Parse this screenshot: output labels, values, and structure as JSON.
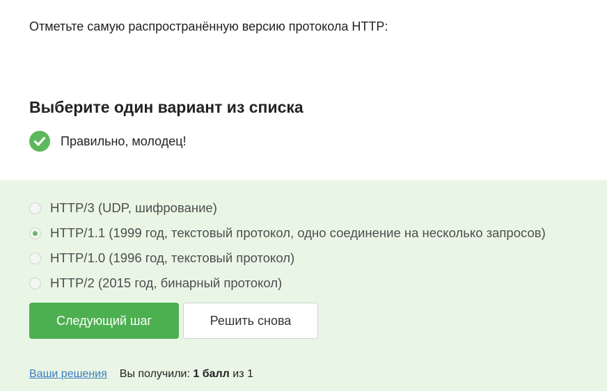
{
  "question": {
    "text": "Отметьте самую распространённую версию протокола HTTP:"
  },
  "choose_title": "Выберите один вариант из списка",
  "feedback": {
    "icon": "check-circle-icon",
    "text": "Правильно, молодец!",
    "color": "#5cb85c"
  },
  "options": [
    {
      "label": "HTTP/3 (UDP, шифрование)",
      "checked": false
    },
    {
      "label": "HTTP/1.1 (1999 год, текстовый протокол, одно соединение на несколько запросов)",
      "checked": true
    },
    {
      "label": "HTTP/1.0 (1996 год, текстовый протокол)",
      "checked": false
    },
    {
      "label": "HTTP/2 (2015 год, бинарный протокол)",
      "checked": false
    }
  ],
  "buttons": {
    "next_label": "Следующий шаг",
    "retry_label": "Решить снова"
  },
  "footer": {
    "solutions_link": "Ваши решения",
    "score_prefix": "Вы получили:",
    "score_value": "1 балл",
    "score_suffix": "из 1"
  },
  "colors": {
    "panel_bg": "#e9f6e6",
    "accent": "#4caf50",
    "link": "#3b7bbf"
  }
}
